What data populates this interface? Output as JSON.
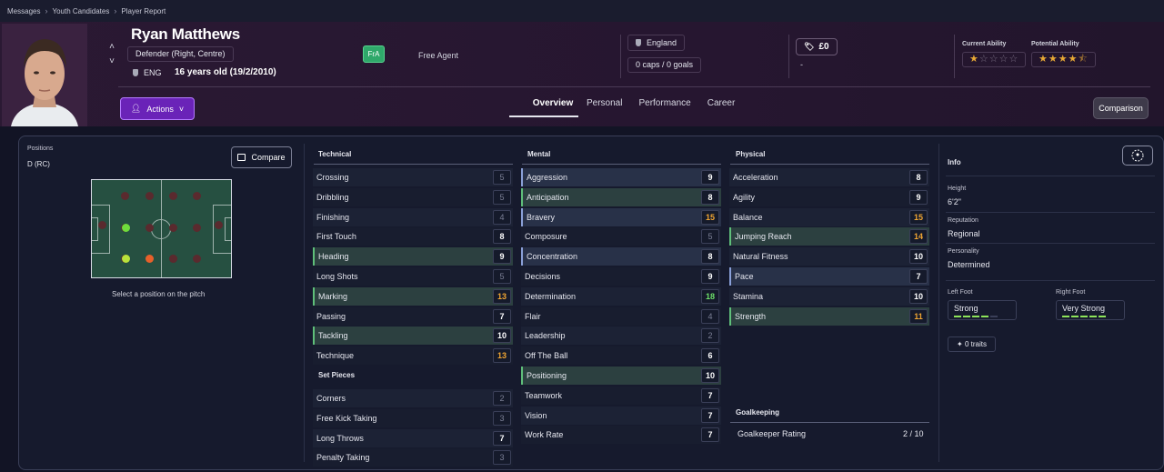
{
  "breadcrumb": [
    "Messages",
    "Youth Candidates",
    "Player Report"
  ],
  "player": {
    "name": "Ryan Matthews",
    "position": "Defender (Right, Centre)",
    "nation_code": "ENG",
    "age": "16 years old (19/2/2010)",
    "status_badge": "FrA",
    "contract": "Free Agent",
    "nation": "England",
    "caps": "0 caps / 0 goals",
    "value": "£0",
    "value_sub": "-",
    "current_ability_label": "Current Ability",
    "potential_ability_label": "Potential Ability",
    "current_ability_stars": 1,
    "potential_ability_stars": 4.5
  },
  "actions_label": "Actions",
  "tabs": [
    "Overview",
    "Personal",
    "Performance",
    "Career"
  ],
  "comparison_label": "Comparison",
  "positions": {
    "label": "Positions",
    "value": "D (RC)",
    "compare_label": "Compare",
    "hint": "Select a position on the pitch"
  },
  "technical": {
    "title": "Technical",
    "rows": [
      {
        "name": "Crossing",
        "value": "5",
        "style": "dim",
        "hl": ""
      },
      {
        "name": "Dribbling",
        "value": "5",
        "style": "dim",
        "hl": ""
      },
      {
        "name": "Finishing",
        "value": "4",
        "style": "dim",
        "hl": ""
      },
      {
        "name": "First Touch",
        "value": "8",
        "style": "",
        "hl": ""
      },
      {
        "name": "Heading",
        "value": "9",
        "style": "",
        "hl": "hl"
      },
      {
        "name": "Long Shots",
        "value": "5",
        "style": "dim",
        "hl": ""
      },
      {
        "name": "Marking",
        "value": "13",
        "style": "orange",
        "hl": "hl"
      },
      {
        "name": "Passing",
        "value": "7",
        "style": "",
        "hl": ""
      },
      {
        "name": "Tackling",
        "value": "10",
        "style": "",
        "hl": "hl"
      },
      {
        "name": "Technique",
        "value": "13",
        "style": "orange",
        "hl": ""
      }
    ]
  },
  "set_pieces": {
    "title": "Set Pieces",
    "rows": [
      {
        "name": "Corners",
        "value": "2",
        "style": "dim",
        "hl": ""
      },
      {
        "name": "Free Kick Taking",
        "value": "3",
        "style": "dim",
        "hl": ""
      },
      {
        "name": "Long Throws",
        "value": "7",
        "style": "",
        "hl": ""
      },
      {
        "name": "Penalty Taking",
        "value": "3",
        "style": "dim",
        "hl": ""
      }
    ]
  },
  "mental": {
    "title": "Mental",
    "rows": [
      {
        "name": "Aggression",
        "value": "9",
        "style": "",
        "hl": "hlb"
      },
      {
        "name": "Anticipation",
        "value": "8",
        "style": "",
        "hl": "hl"
      },
      {
        "name": "Bravery",
        "value": "15",
        "style": "orange",
        "hl": "hlb"
      },
      {
        "name": "Composure",
        "value": "5",
        "style": "dim",
        "hl": ""
      },
      {
        "name": "Concentration",
        "value": "8",
        "style": "",
        "hl": "hlb"
      },
      {
        "name": "Decisions",
        "value": "9",
        "style": "",
        "hl": ""
      },
      {
        "name": "Determination",
        "value": "18",
        "style": "green",
        "hl": ""
      },
      {
        "name": "Flair",
        "value": "4",
        "style": "dim",
        "hl": ""
      },
      {
        "name": "Leadership",
        "value": "2",
        "style": "dim",
        "hl": ""
      },
      {
        "name": "Off The Ball",
        "value": "6",
        "style": "",
        "hl": ""
      },
      {
        "name": "Positioning",
        "value": "10",
        "style": "",
        "hl": "hl"
      },
      {
        "name": "Teamwork",
        "value": "7",
        "style": "",
        "hl": ""
      },
      {
        "name": "Vision",
        "value": "7",
        "style": "",
        "hl": ""
      },
      {
        "name": "Work Rate",
        "value": "7",
        "style": "",
        "hl": ""
      }
    ]
  },
  "physical": {
    "title": "Physical",
    "rows": [
      {
        "name": "Acceleration",
        "value": "8",
        "style": "",
        "hl": ""
      },
      {
        "name": "Agility",
        "value": "9",
        "style": "",
        "hl": ""
      },
      {
        "name": "Balance",
        "value": "15",
        "style": "orange",
        "hl": ""
      },
      {
        "name": "Jumping Reach",
        "value": "14",
        "style": "orange",
        "hl": "hl"
      },
      {
        "name": "Natural Fitness",
        "value": "10",
        "style": "",
        "hl": ""
      },
      {
        "name": "Pace",
        "value": "7",
        "style": "",
        "hl": "hlb"
      },
      {
        "name": "Stamina",
        "value": "10",
        "style": "",
        "hl": ""
      },
      {
        "name": "Strength",
        "value": "11",
        "style": "orange",
        "hl": "hl"
      }
    ]
  },
  "goalkeeping": {
    "title": "Goalkeeping",
    "label": "Goalkeeper Rating",
    "value": "2 / 10"
  },
  "info": {
    "title": "Info",
    "height_label": "Height",
    "height": "6'2\"",
    "reputation_label": "Reputation",
    "reputation": "Regional",
    "personality_label": "Personality",
    "personality": "Determined",
    "left_foot_label": "Left Foot",
    "left_foot": "Strong",
    "left_foot_level": 4,
    "right_foot_label": "Right Foot",
    "right_foot": "Very Strong",
    "right_foot_level": 5,
    "traits": "0 traits"
  }
}
